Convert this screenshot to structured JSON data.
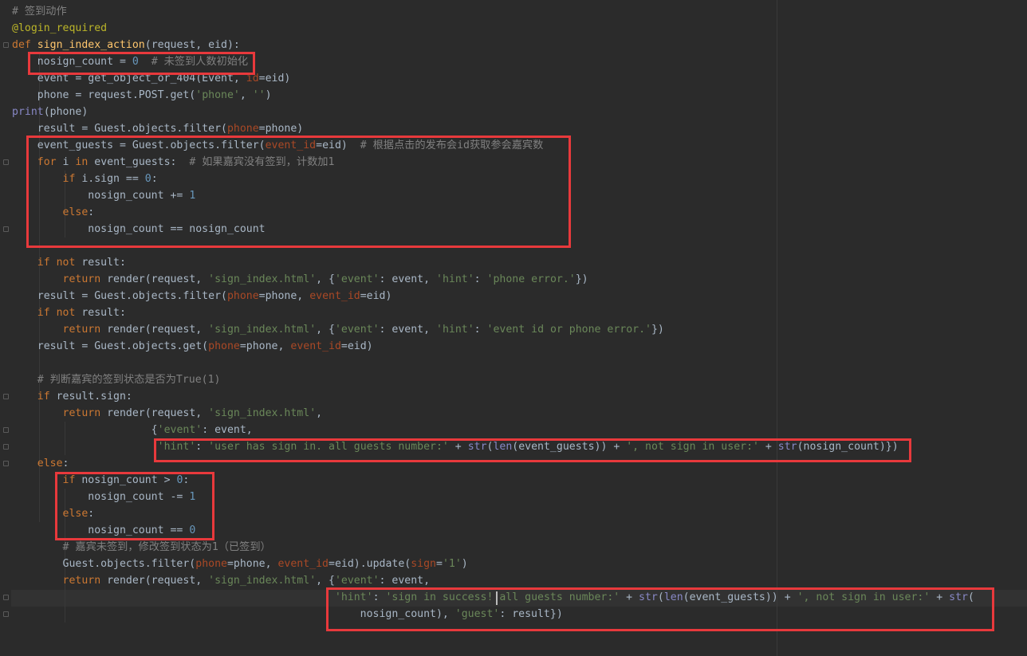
{
  "editor": {
    "theme": "darcula",
    "annotation_color": "#e8393c",
    "lines": [
      [
        [
          "cmt",
          "# 签到动作"
        ]
      ],
      [
        [
          "deco",
          "@login_required"
        ]
      ],
      [
        [
          "kw",
          "def "
        ],
        [
          "fn",
          "sign_index_action"
        ],
        [
          "",
          "(request, eid):"
        ]
      ],
      [
        [
          "",
          "    nosign_count = "
        ],
        [
          "num",
          "0"
        ],
        [
          "cmt",
          "  # 未签到人数初始化"
        ]
      ],
      [
        [
          "",
          "    event = get_object_or_404(Event, "
        ],
        [
          "par",
          "id"
        ],
        [
          "",
          "=eid)"
        ]
      ],
      [
        [
          "",
          "    phone = request.POST.get("
        ],
        [
          "str",
          "'phone'"
        ],
        [
          "",
          ", "
        ],
        [
          "str",
          "''"
        ],
        [
          "",
          ")"
        ]
      ],
      [
        [
          "    ",
          ""
        ],
        [
          "bi",
          "print"
        ],
        [
          "",
          "(phone)"
        ]
      ],
      [
        [
          "",
          "    result = Guest.objects.filter("
        ],
        [
          "par",
          "phone"
        ],
        [
          "",
          "=phone)"
        ]
      ],
      [
        [
          "",
          "    event_guests = Guest.objects.filter("
        ],
        [
          "par",
          "event_id"
        ],
        [
          "",
          "=eid)  "
        ],
        [
          "cmt",
          "# 根据点击的发布会id获取参会嘉宾数"
        ]
      ],
      [
        [
          "",
          "    "
        ],
        [
          "kw",
          "for "
        ],
        [
          "",
          "i "
        ],
        [
          "kw",
          "in "
        ],
        [
          "",
          "event_guests:  "
        ],
        [
          "cmt",
          "# 如果嘉宾没有签到，计数加1"
        ]
      ],
      [
        [
          "",
          "        "
        ],
        [
          "kw",
          "if "
        ],
        [
          "",
          "i.sign == "
        ],
        [
          "num",
          "0"
        ],
        [
          "",
          ":"
        ]
      ],
      [
        [
          "",
          "            nosign_count += "
        ],
        [
          "num",
          "1"
        ]
      ],
      [
        [
          "",
          "        "
        ],
        [
          "kw",
          "else"
        ],
        [
          "",
          ":"
        ]
      ],
      [
        [
          "",
          "            nosign_count == nosign_count"
        ]
      ],
      [
        [
          "",
          ""
        ]
      ],
      [
        [
          "",
          "    "
        ],
        [
          "kw",
          "if not "
        ],
        [
          "",
          "result:"
        ]
      ],
      [
        [
          "",
          "        "
        ],
        [
          "kw",
          "return "
        ],
        [
          "",
          "render(request, "
        ],
        [
          "str",
          "'sign_index.html'"
        ],
        [
          "",
          ", {"
        ],
        [
          "str",
          "'event'"
        ],
        [
          "",
          ": event, "
        ],
        [
          "str",
          "'hint'"
        ],
        [
          "",
          ": "
        ],
        [
          "str",
          "'phone error.'"
        ],
        [
          "",
          "})"
        ]
      ],
      [
        [
          "",
          "    result = Guest.objects.filter("
        ],
        [
          "par",
          "phone"
        ],
        [
          "",
          "=phone, "
        ],
        [
          "par",
          "event_id"
        ],
        [
          "",
          "=eid)"
        ]
      ],
      [
        [
          "",
          "    "
        ],
        [
          "kw",
          "if not "
        ],
        [
          "",
          "result:"
        ]
      ],
      [
        [
          "",
          "        "
        ],
        [
          "kw",
          "return "
        ],
        [
          "",
          "render(request, "
        ],
        [
          "str",
          "'sign_index.html'"
        ],
        [
          "",
          ", {"
        ],
        [
          "str",
          "'event'"
        ],
        [
          "",
          ": event, "
        ],
        [
          "str",
          "'hint'"
        ],
        [
          "",
          ": "
        ],
        [
          "str",
          "'event id or phone error.'"
        ],
        [
          "",
          "})"
        ]
      ],
      [
        [
          "",
          "    result = Guest.objects.get("
        ],
        [
          "par",
          "phone"
        ],
        [
          "",
          "=phone, "
        ],
        [
          "par",
          "event_id"
        ],
        [
          "",
          "=eid)"
        ]
      ],
      [
        [
          "",
          ""
        ]
      ],
      [
        [
          "",
          "    "
        ],
        [
          "cmt",
          "# 判断嘉宾的签到状态是否为True(1)"
        ]
      ],
      [
        [
          "",
          "    "
        ],
        [
          "kw",
          "if "
        ],
        [
          "",
          "result.sign:"
        ]
      ],
      [
        [
          "",
          "        "
        ],
        [
          "kw",
          "return "
        ],
        [
          "",
          "render(request, "
        ],
        [
          "str",
          "'sign_index.html'"
        ],
        [
          "",
          ","
        ]
      ],
      [
        [
          "",
          "                      {"
        ],
        [
          "str",
          "'event'"
        ],
        [
          "",
          ": event,"
        ]
      ],
      [
        [
          "",
          "                       "
        ],
        [
          "str",
          "'hint'"
        ],
        [
          "",
          ": "
        ],
        [
          "str",
          "'user has sign in. all guests number:'"
        ],
        [
          "",
          " + "
        ],
        [
          "bi",
          "str"
        ],
        [
          "",
          "("
        ],
        [
          "bi",
          "len"
        ],
        [
          "",
          "(event_guests)) + "
        ],
        [
          "str",
          "', not sign in user:'"
        ],
        [
          "",
          " + "
        ],
        [
          "bi",
          "str"
        ],
        [
          "",
          "(nosign_count)})"
        ]
      ],
      [
        [
          "",
          "    "
        ],
        [
          "kw",
          "else"
        ],
        [
          "",
          ":"
        ]
      ],
      [
        [
          "",
          "        "
        ],
        [
          "kw",
          "if "
        ],
        [
          "",
          "nosign_count > "
        ],
        [
          "num",
          "0"
        ],
        [
          "",
          ":"
        ]
      ],
      [
        [
          "",
          "            nosign_count -= "
        ],
        [
          "num",
          "1"
        ]
      ],
      [
        [
          "",
          "        "
        ],
        [
          "kw",
          "else"
        ],
        [
          "",
          ":"
        ]
      ],
      [
        [
          "",
          "            nosign_count == "
        ],
        [
          "num",
          "0"
        ]
      ],
      [
        [
          "",
          "        "
        ],
        [
          "cmt",
          "# 嘉宾未签到，修改签到状态为1（已签到）"
        ]
      ],
      [
        [
          "",
          "        Guest.objects.filter("
        ],
        [
          "par",
          "phone"
        ],
        [
          "",
          "=phone, "
        ],
        [
          "par",
          "event_id"
        ],
        [
          "",
          "=eid).update("
        ],
        [
          "par",
          "sign"
        ],
        [
          "",
          "="
        ],
        [
          "str",
          "'1'"
        ],
        [
          "",
          ")"
        ]
      ],
      [
        [
          "",
          "        "
        ],
        [
          "kw",
          "return "
        ],
        [
          "",
          "render(request, "
        ],
        [
          "str",
          "'sign_index.html'"
        ],
        [
          "",
          ", {"
        ],
        [
          "str",
          "'event'"
        ],
        [
          "",
          ": event,"
        ]
      ],
      [
        [
          "",
          "                                                   "
        ],
        [
          "str",
          "'hint'"
        ],
        [
          "",
          ": "
        ],
        [
          "str",
          "'sign in success! all guests number:'"
        ],
        [
          "",
          " + "
        ],
        [
          "bi",
          "str"
        ],
        [
          "",
          "("
        ],
        [
          "bi",
          "len"
        ],
        [
          "",
          "(event_guests)) + "
        ],
        [
          "str",
          "', not sign in user:'"
        ],
        [
          "",
          " + "
        ],
        [
          "bi",
          "str"
        ],
        [
          "",
          "("
        ]
      ],
      [
        [
          "",
          "                                                       nosign_count), "
        ],
        [
          "str",
          "'guest'"
        ],
        [
          "",
          ": result})"
        ]
      ]
    ]
  }
}
